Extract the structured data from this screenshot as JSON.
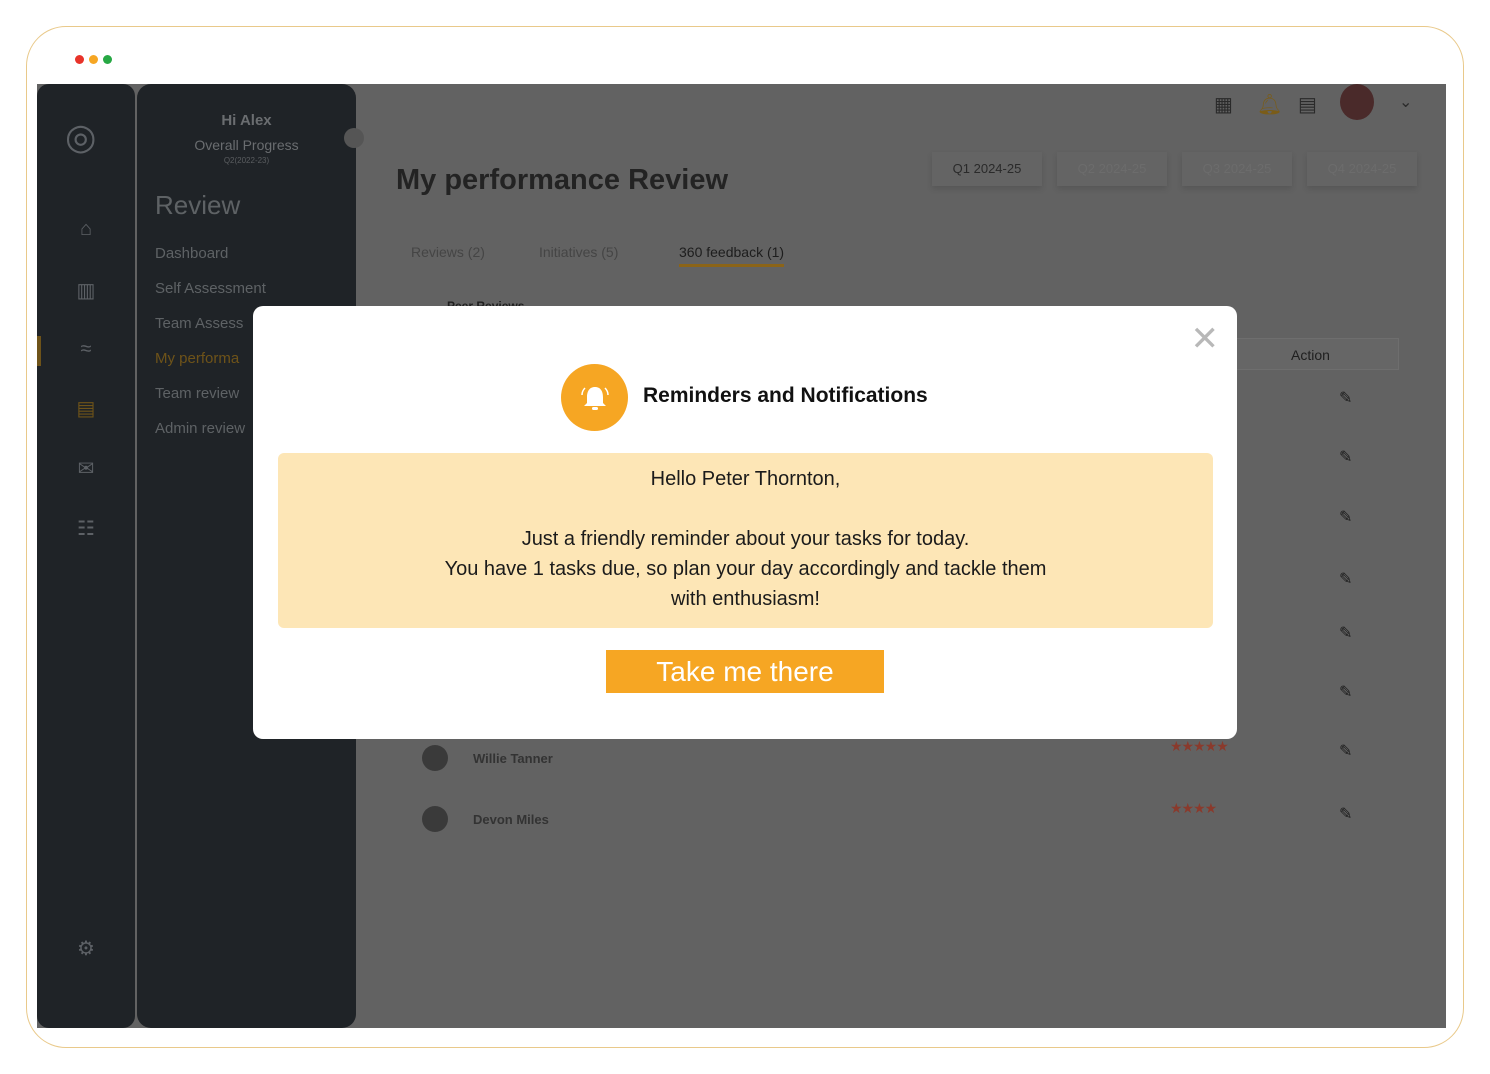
{
  "window": {
    "dots": [
      "#e8332a",
      "#f6a623",
      "#27a844"
    ]
  },
  "sidebar": {
    "greeting": "Hi Alex",
    "progress_label": "Overall Progress",
    "period": "Q2(2022-23)",
    "section": "Review",
    "items": [
      {
        "label": "Dashboard"
      },
      {
        "label": "Self Assessment"
      },
      {
        "label": "Team Assess"
      },
      {
        "label": "My performa"
      },
      {
        "label": "Team review"
      },
      {
        "label": "Admin review"
      }
    ]
  },
  "page": {
    "title": "My performance Review",
    "quarters": [
      "Q1 2024-25",
      "Q2 2024-25",
      "Q3 2024-25",
      "Q4 2024-25"
    ],
    "tabs": [
      "Reviews (2)",
      "Initiatives (5)",
      "360 feedback (1)"
    ],
    "subtabs": [
      "Peer Reviews"
    ],
    "action_header": "Action",
    "rows": [
      {
        "name": "Willie Tanner",
        "rating": 4.5
      },
      {
        "name": "Devon Miles",
        "rating": 4
      }
    ]
  },
  "modal": {
    "title": "Reminders and Notifications",
    "greeting": "Hello Peter Thornton,",
    "line1": "Just a friendly reminder about your tasks for today.",
    "line2": "You have 1 tasks due, so plan your day accordingly and tackle them",
    "line3": "with enthusiasm!",
    "cta": "Take me there",
    "accent": "#f6a623"
  }
}
